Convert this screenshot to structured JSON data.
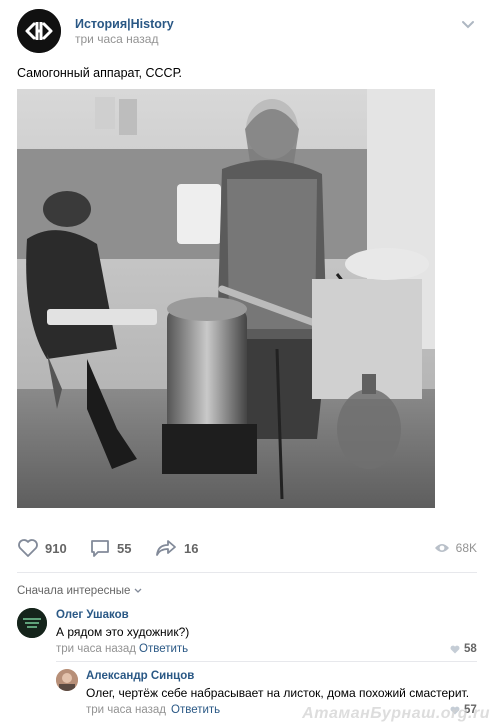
{
  "post": {
    "group_name": "История|History",
    "time": "три часа назад",
    "text": "Самогонный аппарат, СССР.",
    "photo_icon": "photo-bw-moonshine-still"
  },
  "actions": {
    "likes": "910",
    "comments": "55",
    "shares": "16",
    "views": "68K"
  },
  "comments": {
    "sort_label": "Сначала интересные",
    "items": [
      {
        "author": "Олег Ушаков",
        "text": "А рядом это художник?)",
        "time": "три часа назад",
        "reply": "Ответить",
        "likes": "58"
      },
      {
        "author": "Александр Синцов",
        "text": "Олег, чертёж себе набрасывает на листок, дома похожий смастерит.",
        "time": "три часа назад",
        "reply": "Ответить",
        "likes": "57"
      }
    ]
  },
  "watermark": "АтаманБурнаш.org.ru",
  "colors": {
    "link": "#2a5885",
    "meta": "#939393",
    "icon": "#828a99",
    "divider": "#e7e8ec"
  }
}
